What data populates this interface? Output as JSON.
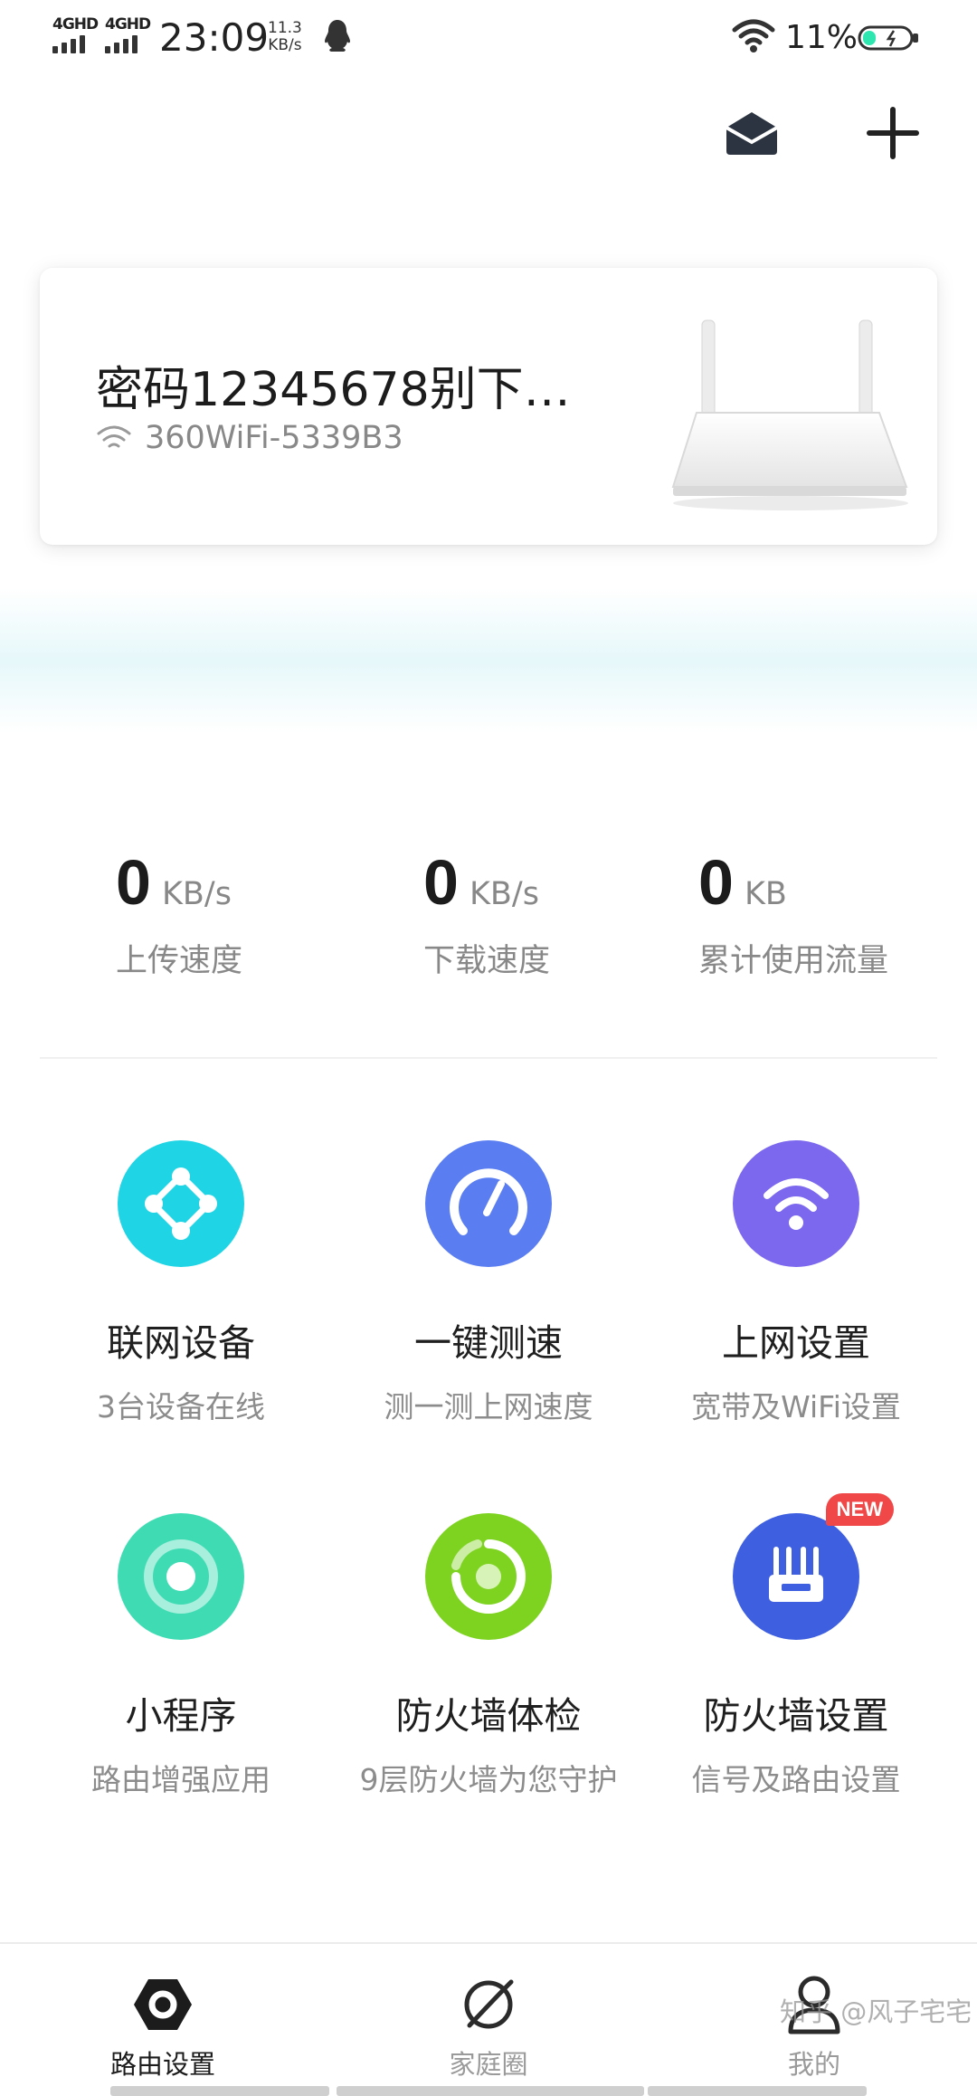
{
  "status_bar": {
    "signal1": "4GHD",
    "signal2": "4GHD",
    "time": "23:09",
    "net_speed_value": "11.3",
    "net_speed_unit": "KB/s",
    "battery": "11%"
  },
  "router": {
    "name": "密码12345678别下…",
    "ssid": "360WiFi-5339B3"
  },
  "stats": [
    {
      "value": "0",
      "unit": "KB/s",
      "label": "上传速度"
    },
    {
      "value": "0",
      "unit": "KB/s",
      "label": "下载速度"
    },
    {
      "value": "0",
      "unit": "KB",
      "label": "累计使用流量"
    }
  ],
  "tiles": [
    {
      "title": "联网设备",
      "subtitle": "3台设备在线",
      "icon": "network-devices-icon",
      "color": "#1fd4e4"
    },
    {
      "title": "一键测速",
      "subtitle": "测一测上网速度",
      "icon": "speedometer-icon",
      "color": "#5a7ef2"
    },
    {
      "title": "上网设置",
      "subtitle": "宽带及WiFi设置",
      "icon": "wifi-icon",
      "color": "#7b68ee"
    },
    {
      "title": "小程序",
      "subtitle": "路由增强应用",
      "icon": "mini-program-icon",
      "color": "#3fdcb4"
    },
    {
      "title": "防火墙体检",
      "subtitle": "9层防火墙为您守护",
      "icon": "firewall-check-icon",
      "color": "#7ed321"
    },
    {
      "title": "防火墙设置",
      "subtitle": "信号及路由设置",
      "icon": "router-icon",
      "color": "#3e5fe0",
      "badge": "NEW"
    }
  ],
  "nav": [
    {
      "label": "路由设置",
      "icon": "hexagon-nut-icon",
      "active": true
    },
    {
      "label": "家庭圈",
      "icon": "planet-icon",
      "active": false
    },
    {
      "label": "我的",
      "icon": "user-icon",
      "active": false
    }
  ],
  "watermark": "知乎 @风子宅宅",
  "colors": {
    "active": "#1c1c1c",
    "inactive": "#9a9a9a"
  }
}
